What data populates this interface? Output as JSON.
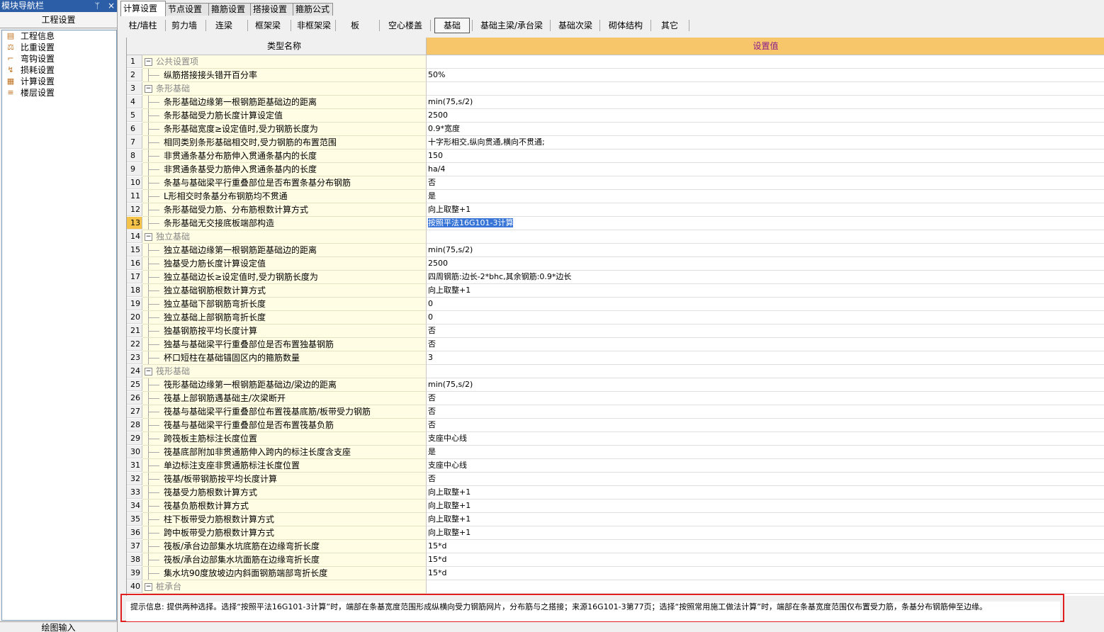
{
  "nav": {
    "title": "模块导航栏",
    "pin": "ᛘ",
    "close": "×",
    "subtitle": "工程设置",
    "items": [
      {
        "label": "工程信息",
        "icon": "project-info-icon"
      },
      {
        "label": "比重设置",
        "icon": "density-icon"
      },
      {
        "label": "弯钩设置",
        "icon": "hook-icon"
      },
      {
        "label": "损耗设置",
        "icon": "loss-icon"
      },
      {
        "label": "计算设置",
        "icon": "calc-icon"
      },
      {
        "label": "楼层设置",
        "icon": "floor-icon"
      }
    ],
    "bottom": "绘图输入"
  },
  "tabs": [
    "计算设置",
    "节点设置",
    "箍筋设置",
    "搭接设置",
    "箍筋公式"
  ],
  "active_tab": 0,
  "subtabs": [
    "柱/墙柱",
    "剪力墙",
    "连梁",
    "框架梁",
    "非框架梁",
    "板",
    "空心楼盖",
    "基础",
    "基础主梁/承台梁",
    "基础次梁",
    "砌体结构",
    "其它"
  ],
  "active_subtab": 7,
  "grid": {
    "col_name": "类型名称",
    "col_value": "设置值",
    "rows": [
      {
        "num": "1",
        "name": "公共设置项",
        "value": "",
        "group": true
      },
      {
        "num": "2",
        "name": "纵筋搭接接头错开百分率",
        "value": "50%"
      },
      {
        "num": "3",
        "name": "条形基础",
        "value": "",
        "group": true
      },
      {
        "num": "4",
        "name": "条形基础边缘第一根钢筋距基础边的距离",
        "value": "min(75,s/2)"
      },
      {
        "num": "5",
        "name": "条形基础受力筋长度计算设定值",
        "value": "2500"
      },
      {
        "num": "6",
        "name": "条形基础宽度≥设定值时,受力钢筋长度为",
        "value": "0.9*宽度"
      },
      {
        "num": "7",
        "name": "相同类别条形基础相交时,受力钢筋的布置范围",
        "value": "十字形相交,纵向贯通,横向不贯通;"
      },
      {
        "num": "8",
        "name": "非贯通条基分布筋伸入贯通条基内的长度",
        "value": "150"
      },
      {
        "num": "9",
        "name": "非贯通条基受力筋伸入贯通条基内的长度",
        "value": "ha/4"
      },
      {
        "num": "10",
        "name": "条基与基础梁平行重叠部位是否布置条基分布钢筋",
        "value": "否"
      },
      {
        "num": "11",
        "name": "L形相交时条基分布钢筋均不贯通",
        "value": "是"
      },
      {
        "num": "12",
        "name": "条形基础受力筋、分布筋根数计算方式",
        "value": "向上取整+1"
      },
      {
        "num": "13",
        "name": "条形基础无交接底板端部构造",
        "value": "按照平法16G101-3计算",
        "selected": true
      },
      {
        "num": "14",
        "name": "独立基础",
        "value": "",
        "group": true
      },
      {
        "num": "15",
        "name": "独立基础边缘第一根钢筋距基础边的距离",
        "value": "min(75,s/2)"
      },
      {
        "num": "16",
        "name": "独基受力筋长度计算设定值",
        "value": "2500"
      },
      {
        "num": "17",
        "name": "独立基础边长≥设定值时,受力钢筋长度为",
        "value": "四周钢筋:边长-2*bhc,其余钢筋:0.9*边长"
      },
      {
        "num": "18",
        "name": "独立基础钢筋根数计算方式",
        "value": "向上取整+1"
      },
      {
        "num": "19",
        "name": "独立基础下部钢筋弯折长度",
        "value": "0"
      },
      {
        "num": "20",
        "name": "独立基础上部钢筋弯折长度",
        "value": "0"
      },
      {
        "num": "21",
        "name": "独基钢筋按平均长度计算",
        "value": "否"
      },
      {
        "num": "22",
        "name": "独基与基础梁平行重叠部位是否布置独基钢筋",
        "value": "否"
      },
      {
        "num": "23",
        "name": "杯口短柱在基础锚固区内的箍筋数量",
        "value": "3"
      },
      {
        "num": "24",
        "name": "筏形基础",
        "value": "",
        "group": true
      },
      {
        "num": "25",
        "name": "筏形基础边缘第一根钢筋距基础边/梁边的距离",
        "value": "min(75,s/2)"
      },
      {
        "num": "26",
        "name": "筏基上部钢筋遇基础主/次梁断开",
        "value": "否"
      },
      {
        "num": "27",
        "name": "筏基与基础梁平行重叠部位布置筏基底筋/板带受力钢筋",
        "value": "否"
      },
      {
        "num": "28",
        "name": "筏基与基础梁平行重叠部位是否布置筏基负筋",
        "value": "否"
      },
      {
        "num": "29",
        "name": "跨筏板主筋标注长度位置",
        "value": "支座中心线"
      },
      {
        "num": "30",
        "name": "筏基底部附加非贯通筋伸入跨内的标注长度含支座",
        "value": "是"
      },
      {
        "num": "31",
        "name": "单边标注支座非贯通筋标注长度位置",
        "value": "支座中心线"
      },
      {
        "num": "32",
        "name": "筏基/板带钢筋按平均长度计算",
        "value": "否"
      },
      {
        "num": "33",
        "name": "筏基受力筋根数计算方式",
        "value": "向上取整+1"
      },
      {
        "num": "34",
        "name": "筏基负筋根数计算方式",
        "value": "向上取整+1"
      },
      {
        "num": "35",
        "name": "柱下板带受力筋根数计算方式",
        "value": "向上取整+1"
      },
      {
        "num": "36",
        "name": "跨中板带受力筋根数计算方式",
        "value": "向上取整+1"
      },
      {
        "num": "37",
        "name": "筏板/承台边部集水坑底筋在边缘弯折长度",
        "value": "15*d"
      },
      {
        "num": "38",
        "name": "筏板/承台边部集水坑面筋在边缘弯折长度",
        "value": "15*d"
      },
      {
        "num": "39",
        "name": "集水坑90度放坡边内斜面钢筋端部弯折长度",
        "value": "15*d"
      },
      {
        "num": "40",
        "name": "桩承台",
        "value": "",
        "group": true
      }
    ]
  },
  "hint": "提示信息: 提供两种选择。选择“按照平法16G101-3计算”时，端部在条基宽度范围形成纵横向受力钢筋网片，分布筋与之搭接；来源16G101-3第77页；选择“按照常用施工做法计算”时，端部在条基宽度范围仅布置受力筋，条基分布钢筋伸至边缘。",
  "colors": {
    "accent": "#2c5ea8",
    "header_bg": "#f8c66a",
    "header_text": "#8b1a8b",
    "name_bg": "#fffde3",
    "highlight": "#e02020"
  }
}
